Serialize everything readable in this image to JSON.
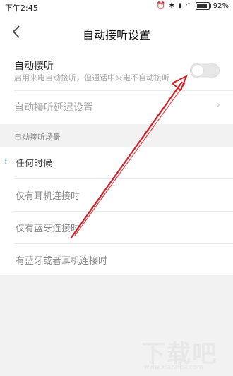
{
  "status": {
    "time": "下午2:45",
    "battery": "92%"
  },
  "header": {
    "title": "自动接听设置"
  },
  "auto_answer": {
    "label": "自动接听",
    "description": "启用来电自动接听，但通话中来电不自动接听",
    "enabled": false
  },
  "delay": {
    "label": "自动接听延迟设置"
  },
  "scenarios": {
    "header": "自动接听场景",
    "options": [
      {
        "label": "任何时候",
        "selected": true
      },
      {
        "label": "仅有耳机连接时",
        "selected": false
      },
      {
        "label": "仅有蓝牙连接时",
        "selected": false
      },
      {
        "label": "有蓝牙或者耳机连接时",
        "selected": false
      }
    ]
  },
  "annotation_color": "#d01f26",
  "watermark": {
    "text": "下载吧",
    "url": "www.xiazaiba.com"
  }
}
